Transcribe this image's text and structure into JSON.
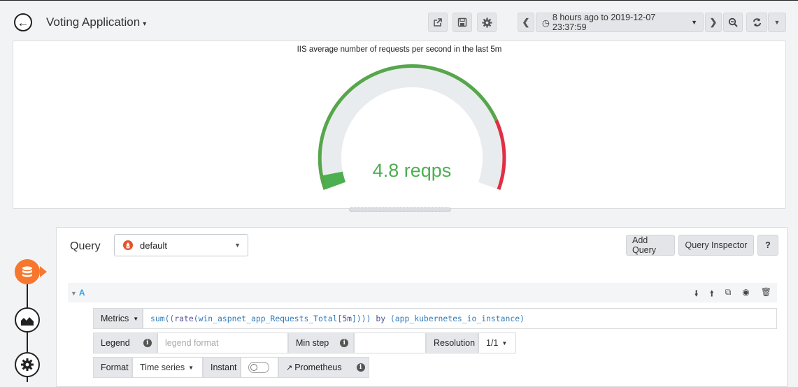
{
  "header": {
    "title": "Voting Application",
    "time_range": "8 hours ago to 2019-12-07 23:37:59"
  },
  "icons": {
    "back": "arrow-left-icon",
    "share": "share-icon",
    "save": "save-icon",
    "settings": "gear-icon",
    "time_back": "chevron-left-icon",
    "clock": "clock-icon",
    "time_forward": "chevron-right-icon",
    "zoom_out": "zoom-out-icon",
    "refresh": "refresh-icon",
    "refresh_menu": "chevron-down-icon",
    "queries": "database-icon",
    "visualization": "chart-area-icon",
    "general": "gear-icon"
  },
  "panel": {
    "title": "IIS average number of requests per second in the last 5m",
    "gauge_value": "4.8 reqps",
    "gauge_level": 0.04,
    "colors": {
      "value": "#4caf50",
      "ok": "#56a64b",
      "critical": "#e02f44",
      "track": "#e9ecef"
    }
  },
  "query_editor": {
    "label": "Query",
    "datasource": "default",
    "add_query": "Add Query",
    "query_inspector": "Query Inspector",
    "help": "?",
    "query_ref": "A",
    "metrics_label": "Metrics",
    "metrics_expr": {
      "p1": "sum((",
      "p2": "rate",
      "p3": "(win_aspnet_app_Requests_Total[",
      "p4": "5m",
      "p5": "]))) ",
      "p6": "by",
      "p7": " (app_kubernetes_io_instance)"
    },
    "legend_label": "Legend",
    "legend_placeholder": "legend format",
    "min_step_label": "Min step",
    "resolution_label": "Resolution",
    "resolution_value": "1/1",
    "format_label": "Format",
    "format_value": "Time series",
    "instant_label": "Instant",
    "prometheus_link": "Prometheus"
  }
}
